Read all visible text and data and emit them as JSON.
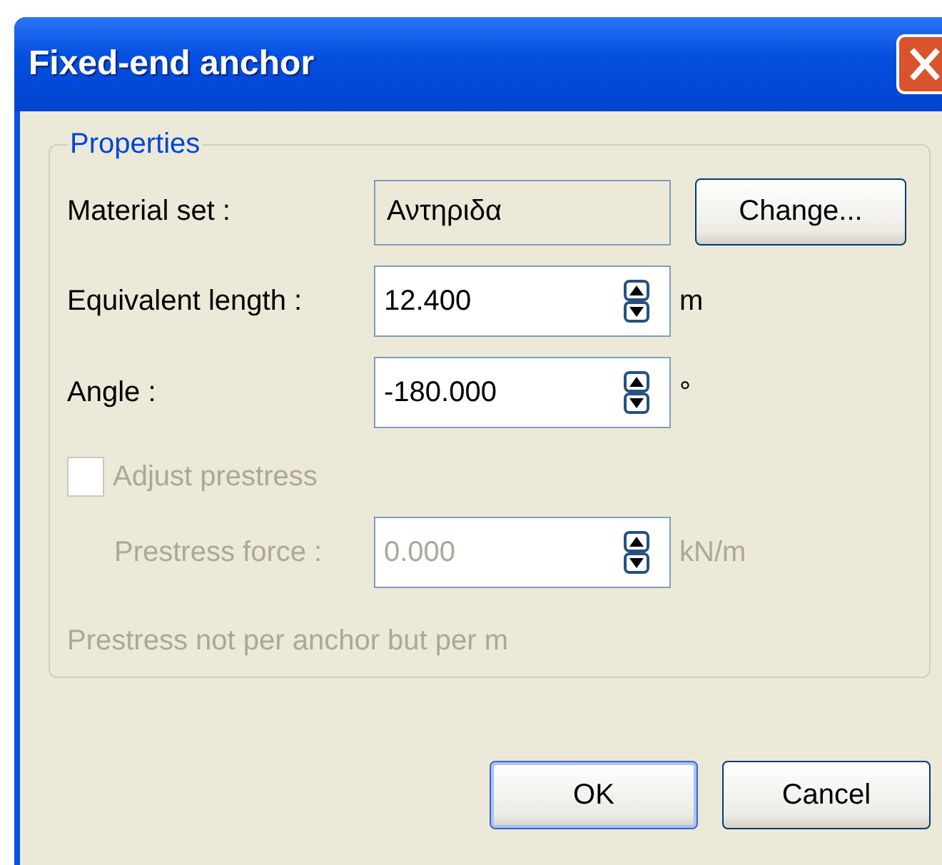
{
  "window": {
    "title": "Fixed-end anchor"
  },
  "group": {
    "title": "Properties"
  },
  "material": {
    "label": "Material set :",
    "value": "Αντηριδα",
    "button": "Change..."
  },
  "fields": [
    {
      "label": "Equivalent length :",
      "value": "12.400",
      "unit": "m",
      "disabled": false
    },
    {
      "label": "Angle :",
      "value": "-180.000",
      "unit": "°",
      "disabled": false
    }
  ],
  "checkbox": {
    "label": "Adjust prestress",
    "checked": false,
    "disabled": true
  },
  "prestress": {
    "label": "Prestress force :",
    "value": "0.000",
    "unit": "kN/m",
    "disabled": true
  },
  "note": {
    "text": "Prestress not per anchor but per m",
    "disabled": true
  },
  "buttons": [
    {
      "label": "OK",
      "default": true
    },
    {
      "label": "Cancel",
      "default": false
    }
  ]
}
